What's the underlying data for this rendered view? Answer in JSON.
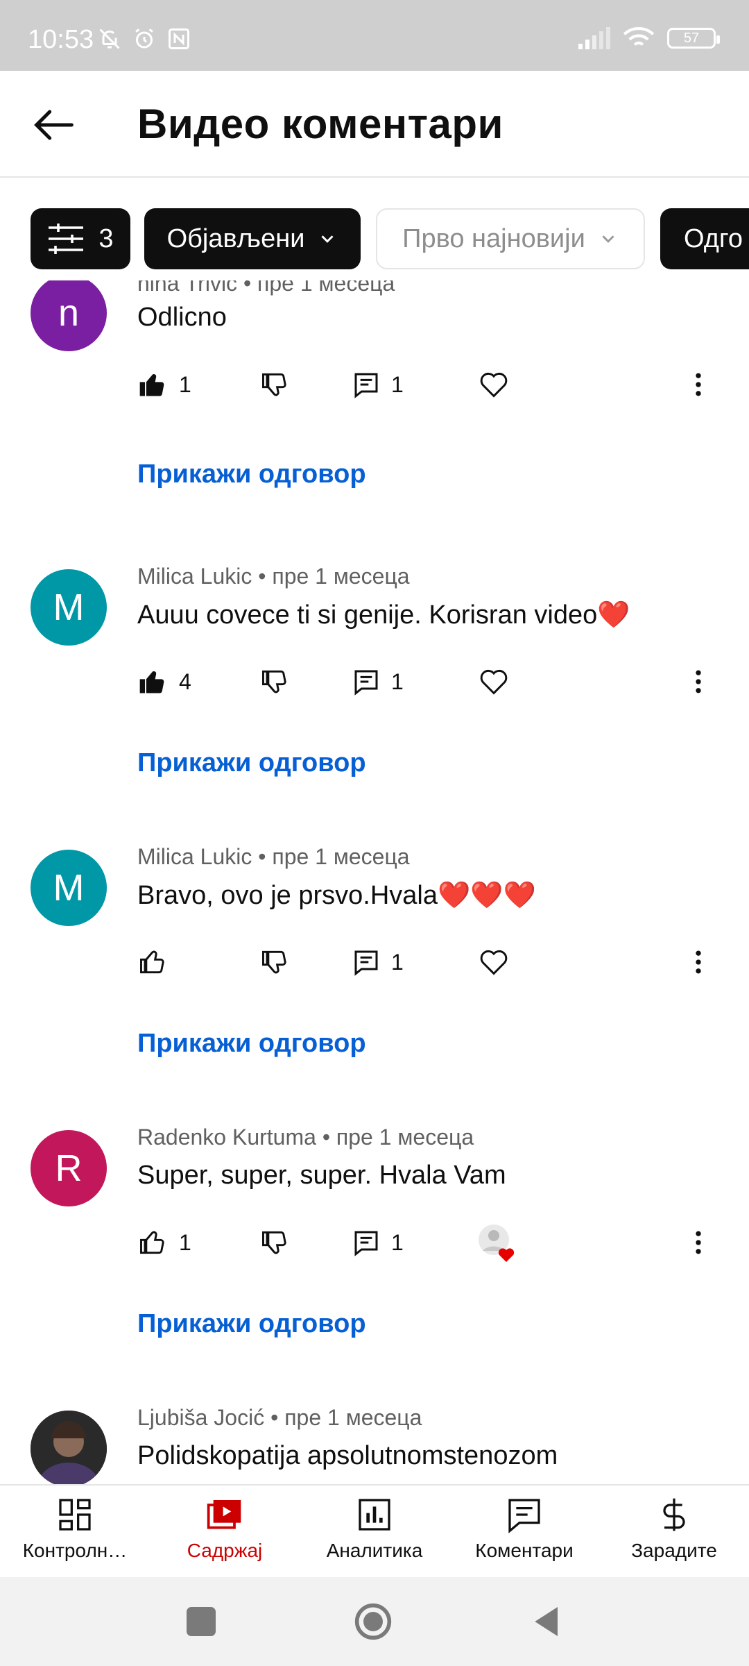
{
  "status_bar": {
    "time": "10:53",
    "battery": "57"
  },
  "header": {
    "title": "Видео коментари"
  },
  "filters": {
    "filter_count": "3",
    "published": "Објављени",
    "sort": "Прво најновији",
    "next_chip": "Одго"
  },
  "comments": [
    {
      "initial": "n",
      "avatar_color": "#7b1fa2",
      "author": "nina Trivic",
      "time": "пре 1 месеца",
      "text": "Odlicno",
      "likes": "1",
      "replies": "1",
      "liked": true,
      "creator_heart": false,
      "show_replies": "Прикажи одговор"
    },
    {
      "initial": "M",
      "avatar_color": "#0097a7",
      "author": "Milica Lukic",
      "time": "пре 1 месеца",
      "text": "Auuu covece ti si genije. Korisran video❤️",
      "likes": "4",
      "replies": "1",
      "liked": true,
      "creator_heart": false,
      "show_replies": "Прикажи одговор"
    },
    {
      "initial": "M",
      "avatar_color": "#0097a7",
      "author": "Milica Lukic",
      "time": "пре 1 месеца",
      "text": "Bravo, ovo je prsvo.Hvala❤️❤️❤️",
      "likes": "",
      "replies": "1",
      "liked": false,
      "creator_heart": false,
      "show_replies": "Прикажи одговор"
    },
    {
      "initial": "R",
      "avatar_color": "#c2185b",
      "author": "Radenko Kurtuma",
      "time": "пре 1 месеца",
      "text": "Super, super, super. Hvala Vam",
      "likes": "1",
      "replies": "1",
      "liked": false,
      "creator_heart": true,
      "show_replies": "Прикажи одговор"
    },
    {
      "initial": "",
      "avatar_color": "#2b2b2b",
      "author": "Ljubiša Jocić",
      "time": "пре 1 месеца",
      "text": "Polidskopatija apsolutnomstenozom",
      "likes": "",
      "replies": "",
      "liked": false,
      "creator_heart": false,
      "show_replies": ""
    }
  ],
  "bottom_nav": {
    "items": [
      {
        "label": "Контролн…",
        "icon": "dashboard-icon"
      },
      {
        "label": "Садржај",
        "icon": "content-icon"
      },
      {
        "label": "Аналитика",
        "icon": "analytics-icon"
      },
      {
        "label": "Коментари",
        "icon": "comments-icon"
      },
      {
        "label": "Зарадите",
        "icon": "earn-icon"
      }
    ],
    "active_index": 1
  },
  "colors": {
    "link": "#065fd4",
    "active": "#cc0000"
  }
}
